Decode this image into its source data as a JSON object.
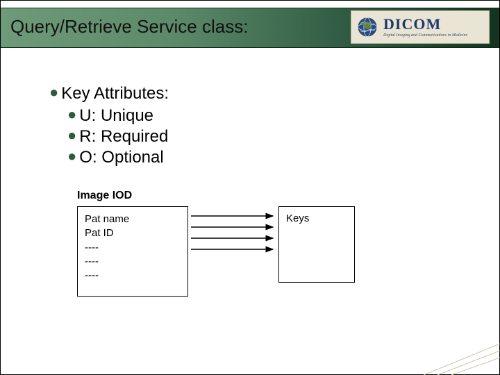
{
  "title": "Query/Retrieve Service class:",
  "logo": {
    "main": "DICOM",
    "sub": "Digital Imaging and Communications in Medicine"
  },
  "bullets": {
    "l1": "Key Attributes:",
    "l2": [
      "U: Unique",
      "R: Required",
      "O: Optional"
    ]
  },
  "diagram": {
    "iod_label": "Image IOD",
    "left_lines": [
      "Pat name",
      "Pat ID",
      "----",
      "----",
      "----"
    ],
    "right_label": "Keys"
  }
}
